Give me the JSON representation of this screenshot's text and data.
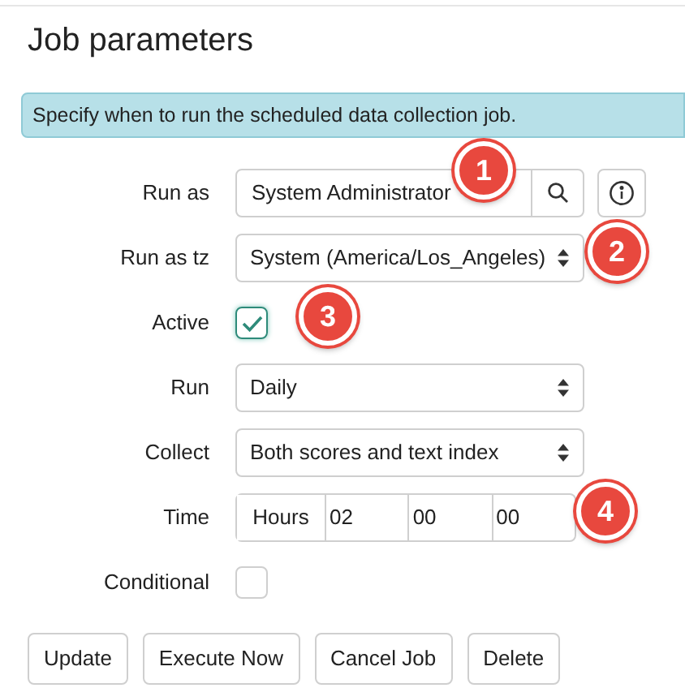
{
  "title": "Job parameters",
  "info_banner": "Specify when to run the scheduled data collection job.",
  "fields": [
    {
      "kind": "lookup",
      "label": "Run as",
      "value": "System Administrator"
    },
    {
      "kind": "select",
      "label": "Run as tz",
      "value": "System (America/Los_Angeles)"
    },
    {
      "kind": "checkbox",
      "label": "Active",
      "checked": true
    },
    {
      "kind": "select",
      "label": "Run",
      "value": "Daily"
    },
    {
      "kind": "select",
      "label": "Collect",
      "value": "Both scores and text index"
    },
    {
      "kind": "time",
      "label": "Time",
      "unit": "Hours",
      "values": [
        "02",
        "00",
        "00"
      ]
    },
    {
      "kind": "checkbox",
      "label": "Conditional",
      "checked": false
    }
  ],
  "buttons": [
    "Update",
    "Execute Now",
    "Cancel Job",
    "Delete"
  ],
  "callouts": [
    "1",
    "2",
    "3",
    "4"
  ]
}
